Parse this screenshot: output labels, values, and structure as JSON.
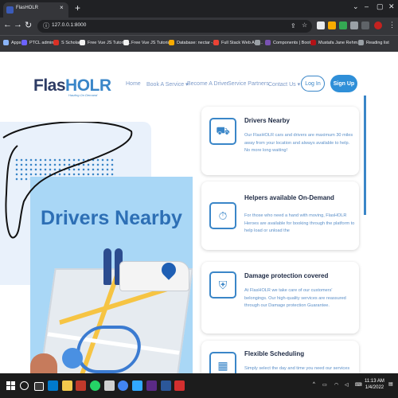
{
  "browser": {
    "tab_title": "FlasHOLR",
    "tab_close": "×",
    "new_tab": "+",
    "url": "127.0.0.1:8000",
    "reading_list": "Reading list",
    "bookmarks": [
      {
        "label": "Apps",
        "color": "#8ab4f8"
      },
      {
        "label": "PTCL admin",
        "color": "#6c63ff"
      },
      {
        "label": "S Scholar",
        "color": "#d93025"
      },
      {
        "label": "Free Vue JS Tutorial...",
        "color": "#f2f2f2"
      },
      {
        "label": "Free Vue JS Tutorial...",
        "color": "#f2f2f2"
      },
      {
        "label": "Database: nectar -...",
        "color": "#f9ab00"
      },
      {
        "label": "Full Stack Web App...",
        "color": "#ea4335"
      },
      {
        "label": "",
        "color": "#9aa0a6"
      },
      {
        "label": "Components | Boot...",
        "color": "#7952b3"
      },
      {
        "label": "Mustafa Jane Rehm...",
        "color": "#b31217"
      }
    ]
  },
  "site": {
    "logo_prefix": "Flas",
    "logo_accent": "HOLR",
    "tagline": "Hauling On Demand",
    "nav": [
      {
        "label": "Home"
      },
      {
        "label": "Book A Service ▾"
      },
      {
        "label": "Become A Driver"
      },
      {
        "label": "Service Partners"
      },
      {
        "label": "Contact Us ▾"
      }
    ],
    "login": "Log In",
    "signup": "Sign Up",
    "hero_title": "Drivers Nearby",
    "accent_color": "#3a86c8"
  },
  "features": [
    {
      "title": "Drivers Nearby",
      "text": "Our FlasHOLR cars and drivers are maximum 30 miles away from your location and always available to help. No more long waiting!",
      "icon": "truck-icon"
    },
    {
      "title": "Helpers available On-Demand",
      "text": "For those who need a hand with moving, FlasHOLR Heroes are available for booking through the platform to help load or unload the",
      "icon": "clock-truck-icon"
    },
    {
      "title": "Damage protection covered",
      "text": "At FlasHOLR we take care of our customers' belongings. Our high-quality services are reassured through our Damage protection Guarantee.",
      "icon": "box-shield-icon"
    },
    {
      "title": "Flexible Scheduling",
      "text": "Simply select the day and time you need our services for.",
      "icon": "calendar-icon"
    }
  ],
  "taskbar": {
    "time": "11:13 AM",
    "date": "1/4/2022"
  }
}
